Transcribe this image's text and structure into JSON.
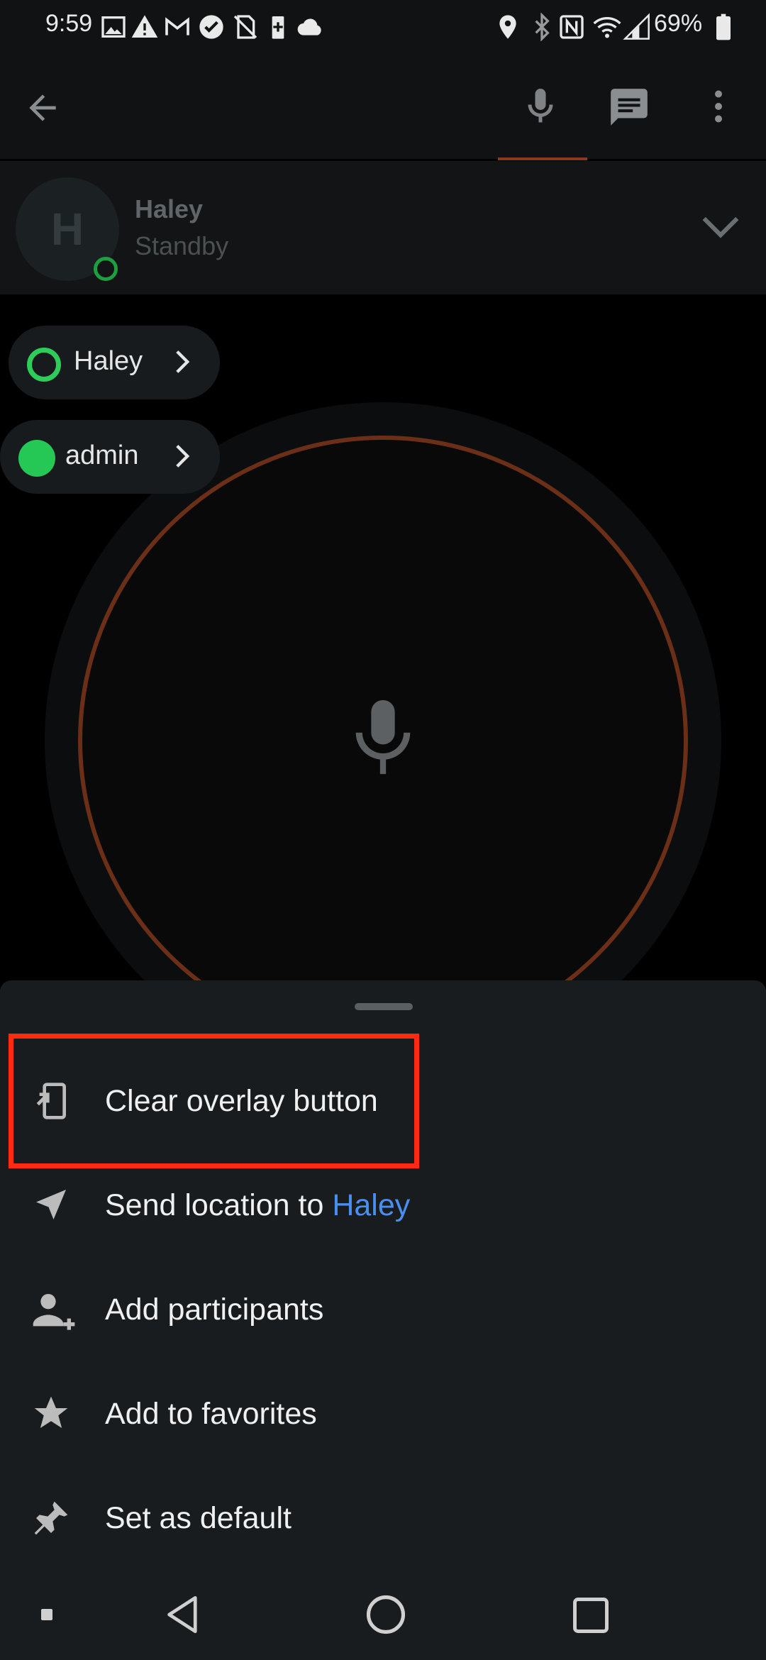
{
  "status_bar": {
    "time": "9:59",
    "battery": "69%",
    "icons": [
      "image-icon",
      "warning-icon",
      "gmail-icon",
      "check-circle-icon",
      "no-sim-icon",
      "battery-saver-icon",
      "cloud-icon",
      "location-icon",
      "bluetooth-icon",
      "nfc-icon",
      "wifi-icon",
      "signal-icon",
      "battery-icon"
    ]
  },
  "app_bar": {
    "icons": [
      "back-arrow-icon",
      "microphone-icon",
      "chat-icon",
      "more-vert-icon"
    ],
    "accent_color": "#8a3a1c"
  },
  "channel": {
    "initial": "H",
    "name": "Haley",
    "status": "Standby"
  },
  "participants": [
    {
      "name": "Haley",
      "state": "ring"
    },
    {
      "name": "admin",
      "state": "filled"
    }
  ],
  "menu": {
    "items": [
      {
        "label": "Clear overlay button",
        "icon": "clear-overlay-icon"
      },
      {
        "label_prefix": "Send location to ",
        "label_accent": "Haley",
        "icon": "navigation-icon"
      },
      {
        "label": "Add participants",
        "icon": "person-add-icon"
      },
      {
        "label": "Add to favorites",
        "icon": "star-icon"
      },
      {
        "label": "Set as default",
        "icon": "pin-icon"
      }
    ],
    "accent_color": "#4a8ff0",
    "highlight_color": "#ff2a10"
  },
  "nav_bar": {
    "icons": [
      "nav-dot-icon",
      "nav-back-icon",
      "nav-home-icon",
      "nav-recents-icon"
    ]
  }
}
